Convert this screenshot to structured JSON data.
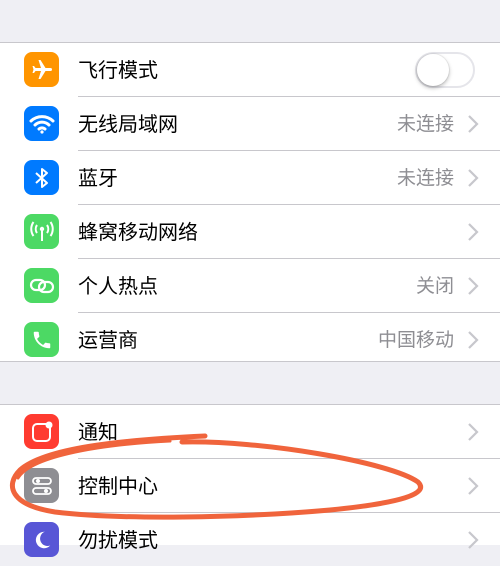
{
  "colors": {
    "background": "#efeff4",
    "airplane": "#ff9500",
    "wifi": "#007aff",
    "bluetooth": "#007aff",
    "cellular": "#4cd964",
    "hotspot": "#4cd964",
    "carrier": "#4cd964",
    "notifications": "#ff3b30",
    "control_center": "#8e8e93",
    "annotation": "#f0643c"
  },
  "settings": {
    "group1": [
      {
        "label": "飞行模式",
        "icon": "airplane-icon",
        "toggle": false
      },
      {
        "label": "无线局域网",
        "icon": "wifi-icon",
        "value": "未连接"
      },
      {
        "label": "蓝牙",
        "icon": "bluetooth-icon",
        "value": "未连接"
      },
      {
        "label": "蜂窝移动网络",
        "icon": "cellular-icon",
        "value": ""
      },
      {
        "label": "个人热点",
        "icon": "hotspot-icon",
        "value": "关闭"
      },
      {
        "label": "运营商",
        "icon": "phone-icon",
        "value": "中国移动"
      }
    ],
    "group2": [
      {
        "label": "通知",
        "icon": "notifications-icon"
      },
      {
        "label": "控制中心",
        "icon": "control-center-icon"
      },
      {
        "label": "勿扰模式",
        "icon": "moon-icon"
      }
    ]
  }
}
